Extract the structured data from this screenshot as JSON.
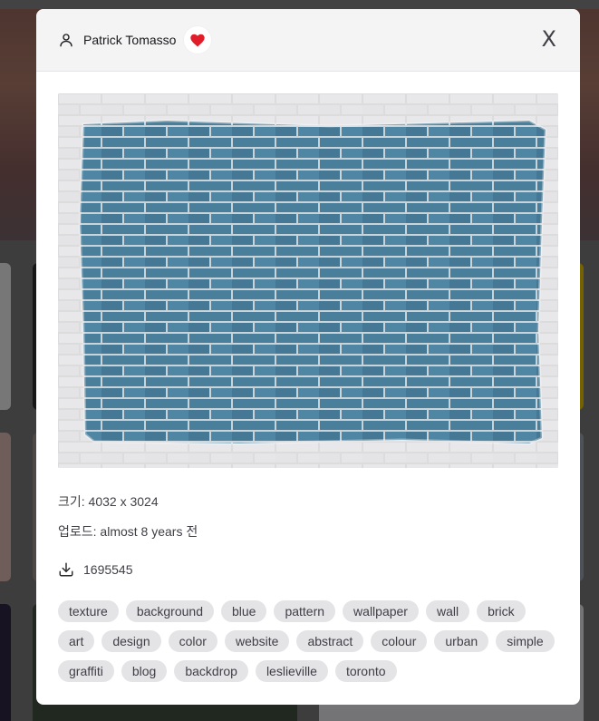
{
  "photographer": {
    "name": "Patrick Tomasso"
  },
  "actions": {
    "close_label": "X",
    "liked": true
  },
  "photo": {
    "description": "blue painted brick wall",
    "accent": "#4a7f9c"
  },
  "details": {
    "size_label": "크기: 4032 x 3024",
    "uploaded_label": "업로드: almost 8 years 전",
    "downloads": "1695545"
  },
  "tags": [
    "texture",
    "background",
    "blue",
    "pattern",
    "wallpaper",
    "wall",
    "brick",
    "art",
    "design",
    "color",
    "website",
    "abstract",
    "colour",
    "urban",
    "simple",
    "graffiti",
    "blog",
    "backdrop",
    "leslieville",
    "toronto"
  ],
  "colors": {
    "heart": "#e11d2a",
    "tag_bg": "#e4e4e7",
    "header_bg": "#f4f4f5"
  }
}
